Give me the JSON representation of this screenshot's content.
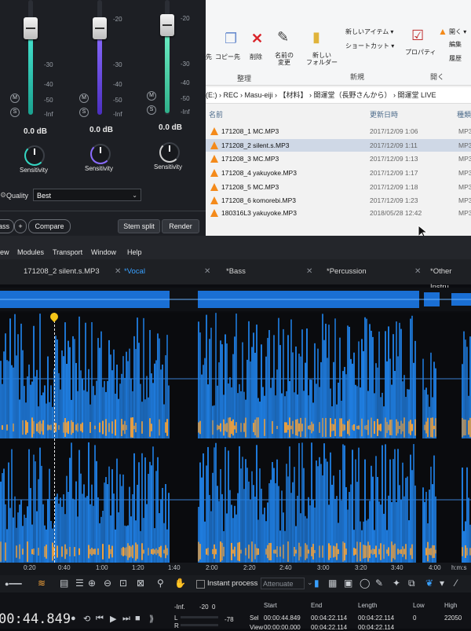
{
  "mixer": {
    "strips": [
      {
        "db": "0.0 dB",
        "sensitivity": "Sensitivity",
        "color": "#33d6c2",
        "knob_color": "#33d6c2"
      },
      {
        "db": "0.0 dB",
        "sensitivity": "Sensitivity",
        "color": "#7b5cff",
        "knob_color": "#8a6bff"
      },
      {
        "db": "0.0 dB",
        "sensitivity": "Sensitivity",
        "color": "#5ce0b8",
        "knob_color": "#cfcfcf"
      }
    ],
    "scale_labels": [
      "-30",
      "-40",
      "-50",
      "-Inf"
    ],
    "scale_labels_full": [
      "-20",
      "-30",
      "-40",
      "-50",
      "-Inf"
    ],
    "m_label": "M",
    "s_label": "S",
    "quality_label": "Quality",
    "quality_value": "Best",
    "buttons": {
      "bass": "ass",
      "plus": "+",
      "compare": "Compare",
      "stem_split": "Stem split",
      "render": "Render"
    }
  },
  "explorer": {
    "ribbon": {
      "partial_left": "先",
      "copy_dest": "コピー先",
      "delete": "削除",
      "rename": "名前の\n変更",
      "new_folder": "新しい\nフォルダー",
      "new_item": "新しいアイテム ▾",
      "shortcut": "ショートカット ▾",
      "properties": "プロパティ",
      "open": "開く ▾",
      "edit": "編集",
      "history": "履歴",
      "group_organize": "整理",
      "group_new": "新規",
      "group_open": "開く"
    },
    "address": "(E:)  ›  REC  ›  Masu-eiji  ›  【材料】  ›  開運堂（長野さんから）  ›  開運堂 LIVE",
    "columns": {
      "name": "名前",
      "date": "更新日時",
      "type": "種類"
    },
    "files": [
      {
        "name": "171208_1 MC.MP3",
        "date": "2017/12/09 1:06",
        "type": "MP3",
        "selected": false
      },
      {
        "name": "171208_2 silent.s.MP3",
        "date": "2017/12/09 1:11",
        "type": "MP3",
        "selected": true
      },
      {
        "name": "171208_3 MC.MP3",
        "date": "2017/12/09 1:13",
        "type": "MP3",
        "selected": false
      },
      {
        "name": "171208_4 yakuyoke.MP3",
        "date": "2017/12/09 1:17",
        "type": "MP3",
        "selected": false
      },
      {
        "name": "171208_5 MC.MP3",
        "date": "2017/12/09 1:18",
        "type": "MP3",
        "selected": false
      },
      {
        "name": "171208_6 komorebi.MP3",
        "date": "2017/12/09 1:23",
        "type": "MP3",
        "selected": false
      },
      {
        "name": "180316L3 yakuyoke.MP3",
        "date": "2018/05/28 12:42",
        "type": "MP3",
        "selected": false
      }
    ]
  },
  "menubar": {
    "items": [
      "ew",
      "Modules",
      "Transport",
      "Window",
      "Help"
    ]
  },
  "tabs": [
    {
      "label": "171208_2 silent.s.MP3",
      "active": false
    },
    {
      "label": "*Vocal",
      "active": true
    },
    {
      "label": "*Bass",
      "active": false
    },
    {
      "label": "*Percussion",
      "active": false
    },
    {
      "label": "*Other Instru",
      "active": false
    }
  ],
  "timeline": {
    "ticks": [
      "0:20",
      "0:40",
      "1:00",
      "1:20",
      "1:40",
      "2:00",
      "2:20",
      "2:40",
      "3:00",
      "3:20",
      "3:40",
      "4:00"
    ],
    "unit": "h:m:s"
  },
  "toolbar": {
    "instant_process": "Instant process",
    "attenuate": "Attenuate"
  },
  "status": {
    "timecode": "00:44.849",
    "meter_labels": [
      "-Inf.",
      "-20",
      "0"
    ],
    "meter_ticks": [
      "L",
      "R"
    ],
    "meter_readout": "-78",
    "row_labels": [
      "Sel",
      "View"
    ],
    "headers": {
      "start": "Start",
      "end": "End",
      "length": "Length",
      "low": "Low",
      "high": "High"
    },
    "sel": {
      "start": "00:00:44.849",
      "end": "00:04:22.114",
      "length": "00:04:22.114",
      "low": "0",
      "high": "22050"
    },
    "view": {
      "start": "00:00:00.000",
      "end": "00:04:22.114",
      "length": "00:04:22.114"
    }
  },
  "colors": {
    "accent_blue": "#39a0ff",
    "wave_blue": "#1f7de0",
    "spectral_orange": "#f3a23a",
    "playhead": "#f5c518"
  }
}
